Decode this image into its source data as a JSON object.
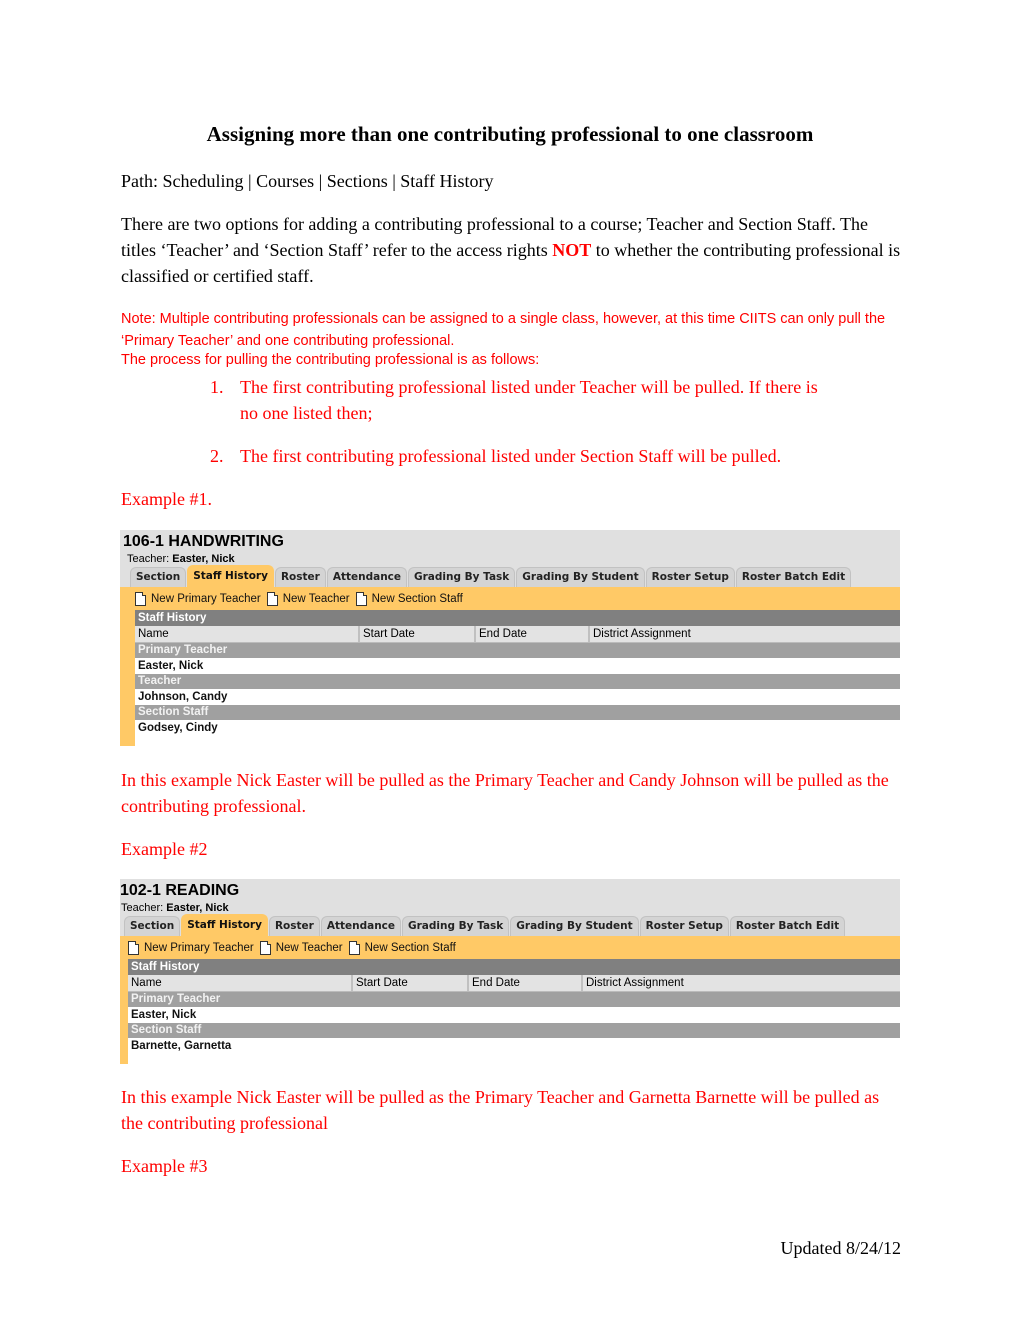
{
  "document": {
    "title": "Assigning more than one contributing professional to one classroom",
    "path": "Path: Scheduling | Courses | Sections | Staff History",
    "intro": {
      "part1": "There are two options for adding a contributing professional to a course; Teacher and Section Staff.  The titles ‘Teacher’ and ‘Section Staff’ refer to the access rights ",
      "emphasis": "NOT",
      "part2": " to whether the contributing professional is classified or certified staff."
    },
    "note": {
      "line1": "Note: Multiple contributing professionals can be assigned to a single class, however, at this time CIITS can only pull the ‘Primary Teacher’ and one contributing professional.",
      "line2": "The process for pulling the contributing professional is as follows:"
    },
    "steps": [
      {
        "num": "1.",
        "text": "The first contributing professional listed under Teacher will be pulled. If there is",
        "cont": "no one listed then;"
      },
      {
        "num": "2.",
        "text": "The first contributing professional listed under Section Staff will be pulled."
      }
    ],
    "examples": [
      {
        "label": "Example #1.",
        "caption": "In this example Nick Easter will be pulled as the Primary Teacher and Candy Johnson will be pulled as the contributing professional."
      },
      {
        "label": "Example #2",
        "caption": "In this example Nick Easter will be pulled as the Primary Teacher and Garnetta Barnette will be pulled as the contributing professional"
      },
      {
        "label": "Example #3"
      }
    ],
    "footer": "Updated 8/24/12"
  },
  "screens": [
    {
      "course": "106-1 HANDWRITING",
      "teacher_label": "Teacher: ",
      "teacher_name": "Easter, Nick",
      "tabs": [
        "Section",
        "Staff History",
        "Roster",
        "Attendance",
        "Grading By Task",
        "Grading By Student",
        "Roster Setup",
        "Roster Batch Edit"
      ],
      "active_tab": "Staff History",
      "toolbar": [
        "New Primary Teacher",
        "New Teacher",
        "New Section Staff"
      ],
      "grid_title": "Staff History",
      "columns": [
        "Name",
        "Start Date",
        "End Date",
        "District Assignment"
      ],
      "groups": [
        {
          "label": "Primary Teacher",
          "rows": [
            "Easter, Nick"
          ]
        },
        {
          "label": "Teacher",
          "rows": [
            "Johnson, Candy"
          ]
        },
        {
          "label": "Section Staff",
          "rows": [
            "Godsey, Cindy"
          ]
        }
      ]
    },
    {
      "course": "102-1 READING",
      "teacher_label": "Teacher: ",
      "teacher_name": "Easter, Nick",
      "tabs": [
        "Section",
        "Staff History",
        "Roster",
        "Attendance",
        "Grading By Task",
        "Grading By Student",
        "Roster Setup",
        "Roster Batch Edit"
      ],
      "active_tab": "Staff History",
      "toolbar": [
        "New Primary Teacher",
        "New Teacher",
        "New Section Staff"
      ],
      "grid_title": "Staff History",
      "columns": [
        "Name",
        "Start Date",
        "End Date",
        "District Assignment"
      ],
      "groups": [
        {
          "label": "Primary Teacher",
          "rows": [
            "Easter, Nick"
          ]
        },
        {
          "label": "Section Staff",
          "rows": [
            "Barnette, Garnetta"
          ]
        }
      ]
    }
  ],
  "colors": {
    "emphasis_red": "#ff0000",
    "active_tab": "#ffc966",
    "grid_title_bg": "#808080",
    "group_bg": "#a0a0a0"
  }
}
